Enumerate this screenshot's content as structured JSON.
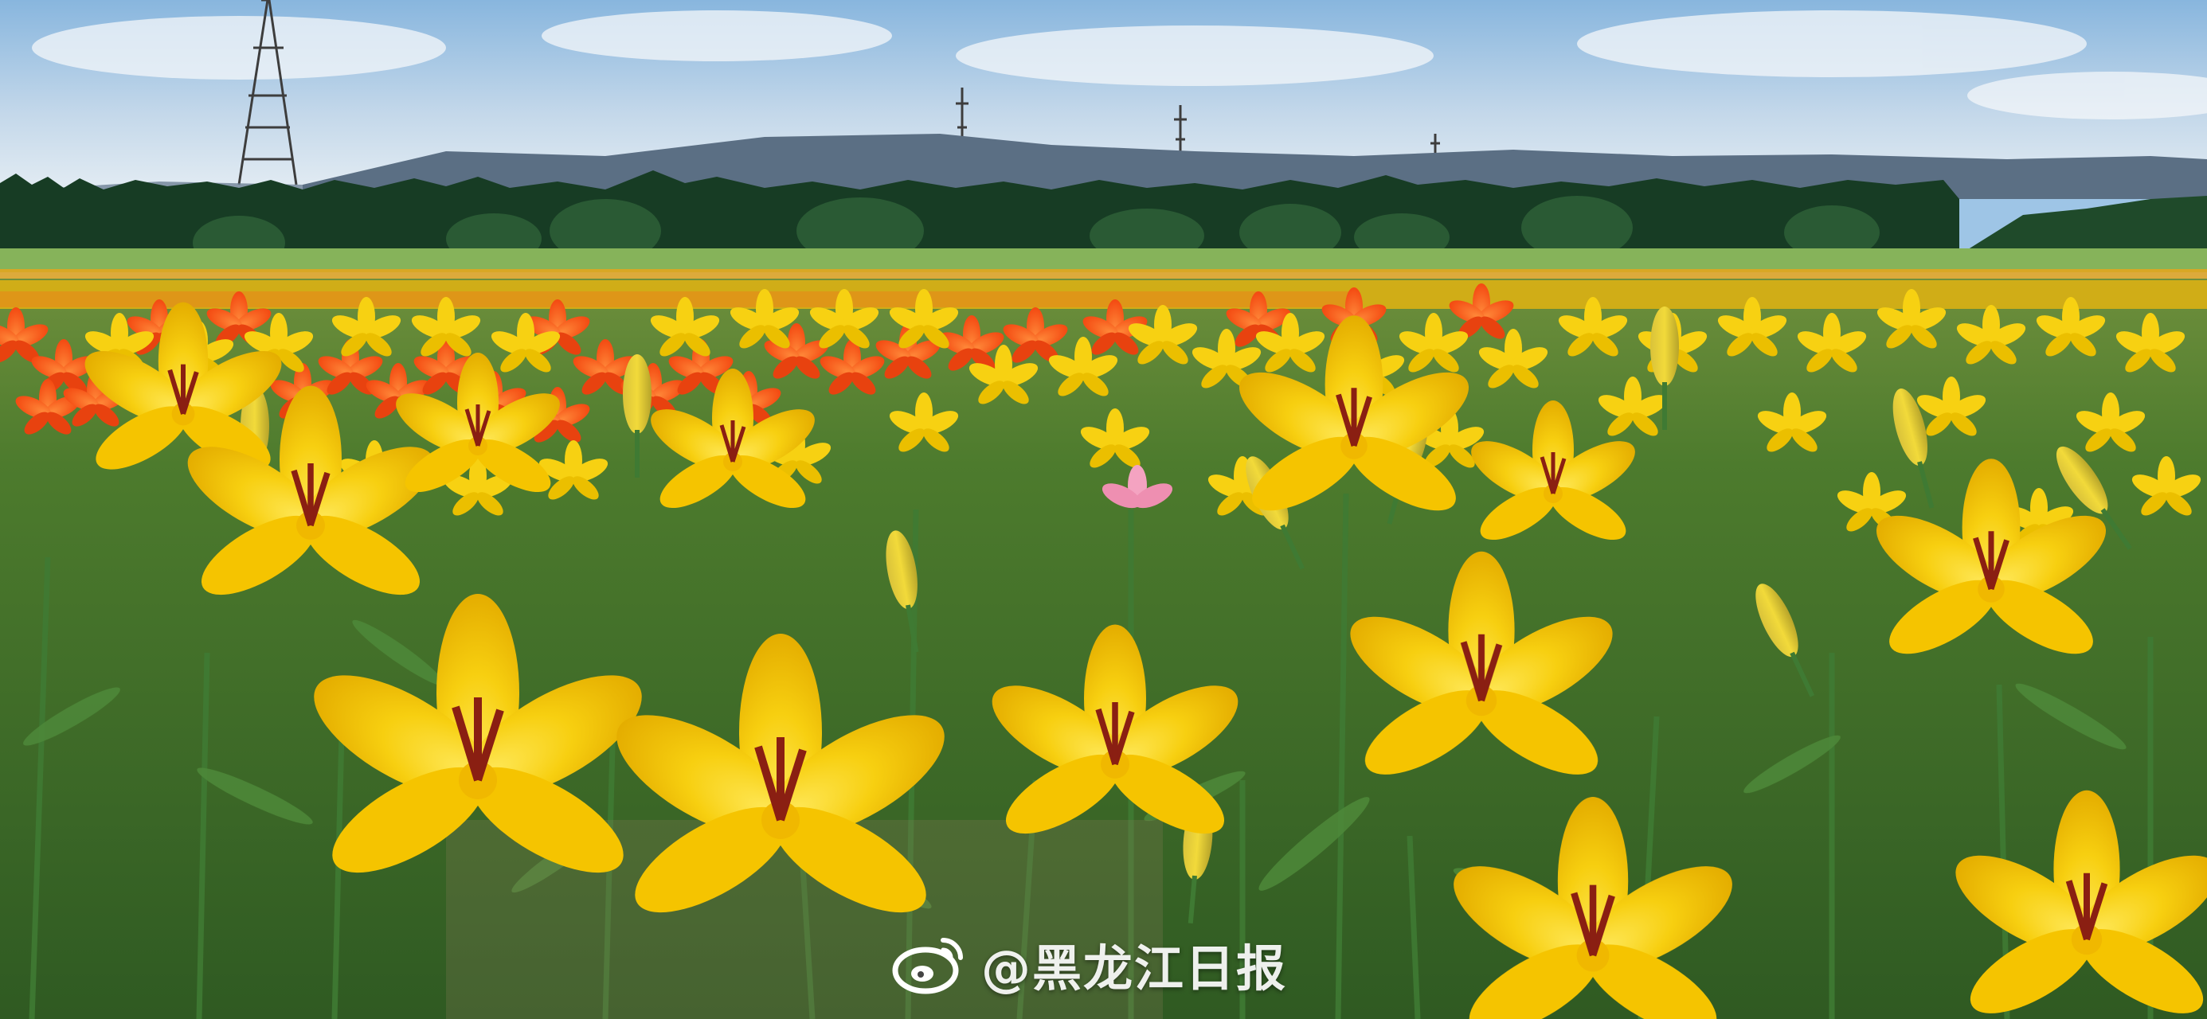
{
  "photo": {
    "subject": "lily-field-landscape",
    "palette": {
      "sky_top": "#8fbbe2",
      "sky_bottom": "#dde8f2",
      "mountains": "#5b6f84",
      "forest": "#163a22",
      "meadow": "#7fae52",
      "foliage": "#3f7a33",
      "lily_yellow": "#f7d112",
      "lily_yellow_deep": "#e9b400",
      "lily_orange": "#ff5a12",
      "lily_pink": "#f4a3c1",
      "stamen": "#8a1f12"
    }
  },
  "watermark": {
    "text": "@黑龙江日报",
    "icon": "weibo-icon"
  }
}
